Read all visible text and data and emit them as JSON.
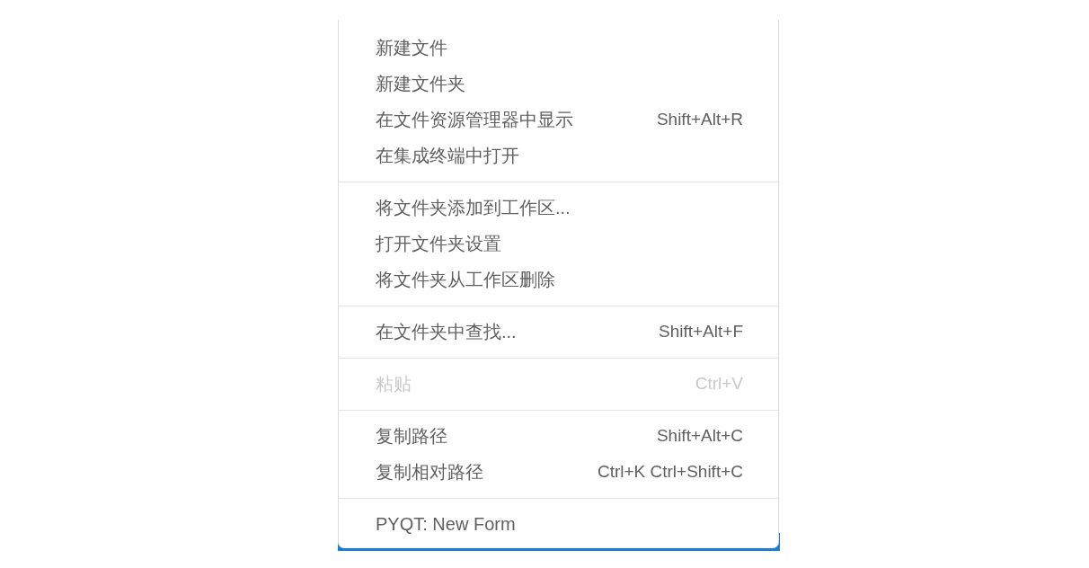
{
  "context_menu": {
    "groups": [
      {
        "items": [
          {
            "label": "新建文件",
            "disabled": false
          },
          {
            "label": "新建文件夹",
            "disabled": false
          },
          {
            "label": "在文件资源管理器中显示",
            "shortcut": "Shift+Alt+R",
            "disabled": false
          },
          {
            "label": "在集成终端中打开",
            "disabled": false
          }
        ]
      },
      {
        "items": [
          {
            "label": "将文件夹添加到工作区...",
            "disabled": false
          },
          {
            "label": "打开文件夹设置",
            "disabled": false
          },
          {
            "label": "将文件夹从工作区删除",
            "disabled": false
          }
        ]
      },
      {
        "items": [
          {
            "label": "在文件夹中查找...",
            "shortcut": "Shift+Alt+F",
            "disabled": false
          }
        ]
      },
      {
        "items": [
          {
            "label": "粘贴",
            "shortcut": "Ctrl+V",
            "disabled": true
          }
        ]
      },
      {
        "items": [
          {
            "label": "复制路径",
            "shortcut": "Shift+Alt+C",
            "disabled": false
          },
          {
            "label": "复制相对路径",
            "shortcut": "Ctrl+K Ctrl+Shift+C",
            "disabled": false
          }
        ]
      },
      {
        "items": [
          {
            "label": "PYQT: New Form",
            "disabled": false
          }
        ]
      }
    ]
  }
}
